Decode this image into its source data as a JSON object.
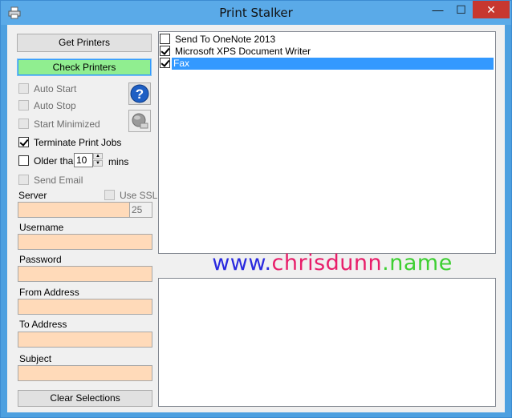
{
  "window": {
    "title": "Print Stalker",
    "minimize": "—",
    "maximize": "☐",
    "close": "✕"
  },
  "buttons": {
    "get_printers": "Get Printers",
    "check_printers": "Check Printers",
    "clear_selections": "Clear Selections"
  },
  "options": {
    "auto_start": {
      "label": "Auto Start",
      "checked": false,
      "enabled": false
    },
    "auto_stop": {
      "label": "Auto Stop",
      "checked": false,
      "enabled": false
    },
    "start_minimized": {
      "label": "Start Minimized",
      "checked": false,
      "enabled": false
    },
    "terminate_print_jobs": {
      "label": "Terminate Print Jobs",
      "checked": true,
      "enabled": true
    },
    "older_than": {
      "label": "Older than",
      "checked": false,
      "enabled": true,
      "value": "10",
      "unit": "mins"
    },
    "send_email": {
      "label": "Send Email",
      "checked": false,
      "enabled": false
    },
    "use_ssl": {
      "label": "Use SSL",
      "checked": false,
      "enabled": false
    }
  },
  "fields": {
    "server": {
      "label": "Server",
      "value": "",
      "port": "25"
    },
    "username": {
      "label": "Username",
      "value": ""
    },
    "password": {
      "label": "Password",
      "value": ""
    },
    "from_address": {
      "label": "From Address",
      "value": ""
    },
    "to_address": {
      "label": "To Address",
      "value": ""
    },
    "subject": {
      "label": "Subject",
      "value": ""
    }
  },
  "printers": [
    {
      "name": "Send To OneNote 2013",
      "checked": false,
      "selected": false
    },
    {
      "name": "Microsoft XPS Document Writer",
      "checked": true,
      "selected": false
    },
    {
      "name": "Fax",
      "checked": true,
      "selected": true
    }
  ],
  "url": {
    "part1": "www.",
    "part2": "chrisdunn",
    "part3": ".name",
    "color1": "#2a2adf",
    "color2": "#e81e6a",
    "color3": "#3ecf32"
  },
  "icons": {
    "app": "printer-icon",
    "help": "help-icon",
    "email": "mail-gear-icon"
  }
}
